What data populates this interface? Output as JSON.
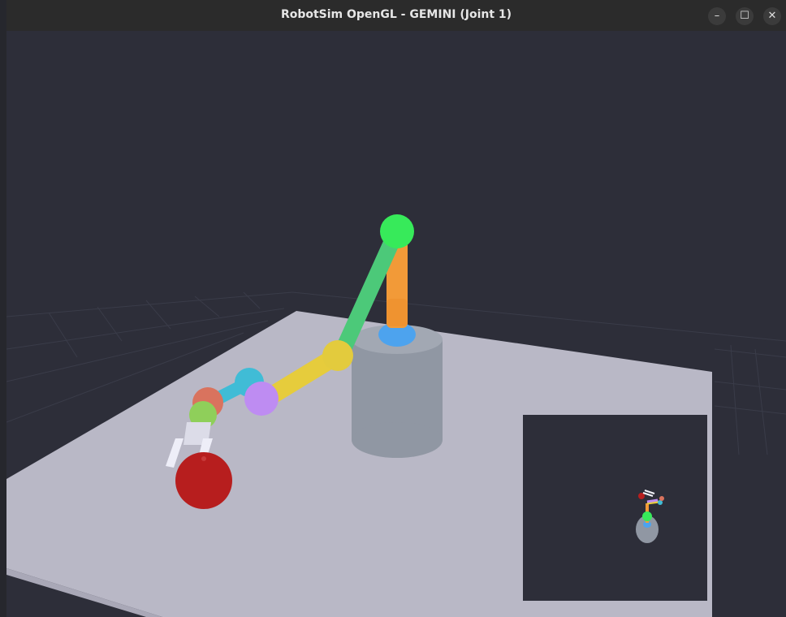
{
  "window": {
    "title": "RobotSim OpenGL - GEMINI (Joint 1)",
    "minimize_glyph": "–",
    "maximize_glyph": "☐",
    "close_glyph": "✕"
  },
  "colors": {
    "background": "#2d2e39",
    "floor": "#b9b8c6",
    "base": "#9097a3",
    "base_joint": "#4da3ee",
    "upright_link": "#f29a38",
    "elbow_joint": "#37ea5a",
    "upper_arm": "#4cc979",
    "wrist_joint": "#e3cb3d",
    "forearm": "#e6cc3c",
    "purple_joint": "#be8cf2",
    "cyan_joint": "#40bcd6",
    "red_joint": "#d9735e",
    "green_joint": "#8fcf5a",
    "gripper": "#e8e7f3",
    "target_ball": "#b71e1e"
  }
}
